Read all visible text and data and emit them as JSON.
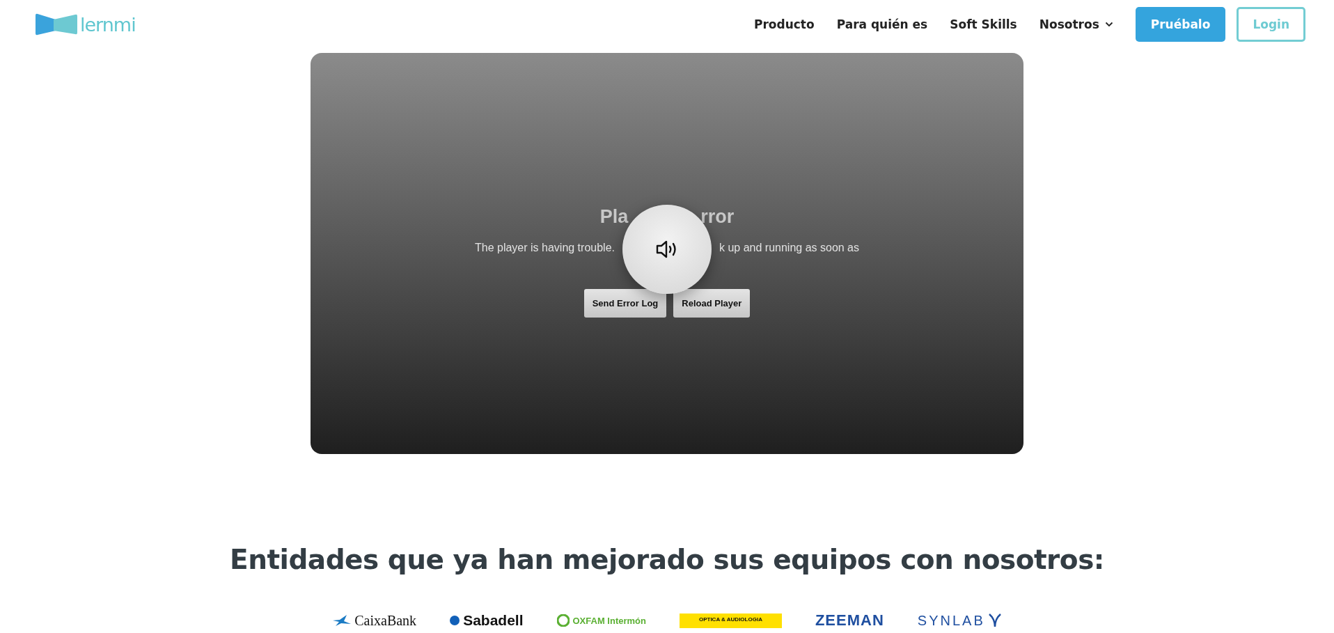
{
  "header": {
    "logo_text": "lernmi",
    "nav": [
      {
        "label": "Producto",
        "dropdown": false
      },
      {
        "label": "Para quién es",
        "dropdown": false
      },
      {
        "label": "Soft Skills",
        "dropdown": false
      },
      {
        "label": "Nosotros",
        "dropdown": true
      }
    ],
    "cta_button": "Pruébalo",
    "login_button": "Login"
  },
  "player": {
    "title_parts": [
      "Pla",
      "rror"
    ],
    "message_parts": [
      "The player is having trouble.",
      "k up and running as soon as"
    ],
    "buttons": [
      "Send Error Log",
      "Reload Player"
    ],
    "muted": false
  },
  "partners": {
    "heading": "Entidades que ya han mejorado sus equipos con nosotros:",
    "logos": [
      {
        "kind": "caixa",
        "text": "CaixaBank"
      },
      {
        "kind": "sabadell",
        "text": "Sabadell"
      },
      {
        "kind": "oxfam",
        "text": "OXFAM Intermón"
      },
      {
        "kind": "optica",
        "text": "OPTICA & AUDIOLOGIA"
      },
      {
        "kind": "zeeman",
        "text": "ZEEMAN"
      },
      {
        "kind": "synlab",
        "text": "SYNLAB"
      }
    ]
  }
}
